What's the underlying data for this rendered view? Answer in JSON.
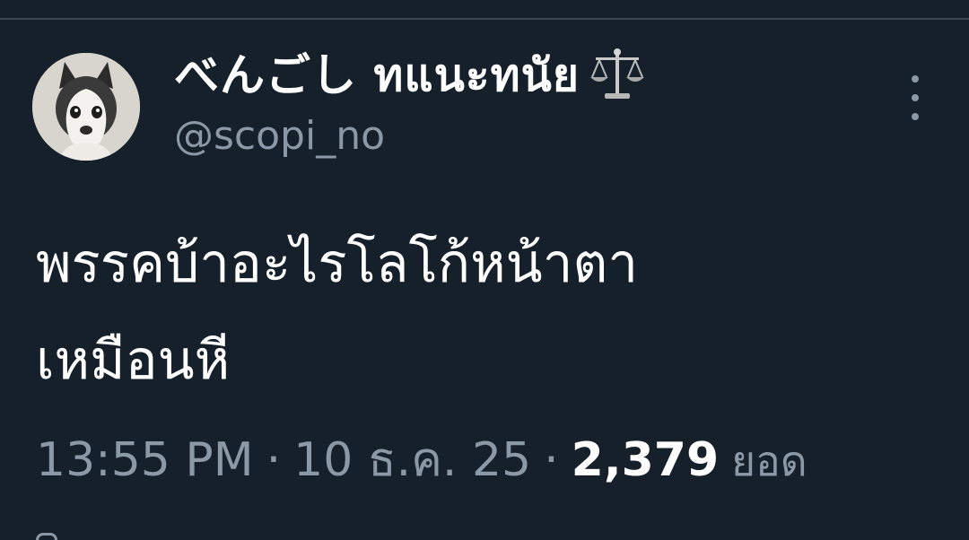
{
  "author": {
    "display_name": "べんごし ทแนะทนัย",
    "badge_icon": "balance-scale-icon",
    "handle": "@scopi_no"
  },
  "tweet": {
    "text": "พรรคบ้าอะไรโลโก้หน้าตา\nเหมือนหี"
  },
  "meta": {
    "time": "13:55 PM",
    "separator": "·",
    "date": "10 ธ.ค. 25",
    "views_count": "2,379",
    "views_label": "ยอด"
  },
  "colors": {
    "background": "#15202b",
    "primary_text": "#ffffff",
    "secondary_text": "#8b98a5",
    "divider": "#38444d"
  }
}
